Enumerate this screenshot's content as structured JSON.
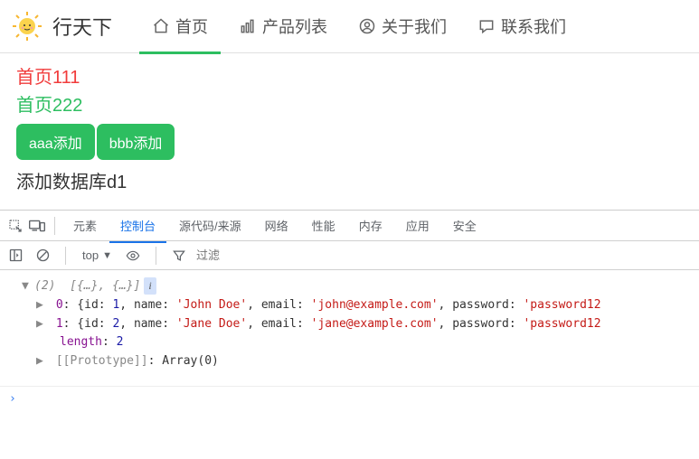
{
  "brand": "行天下",
  "nav": {
    "home": "首页",
    "products": "产品列表",
    "about": "关于我们",
    "contact": "联系我们"
  },
  "page": {
    "t1": "首页111",
    "t2": "首页222",
    "btn_a": "aaa添加",
    "btn_b": "bbb添加",
    "db": "添加数据库d1"
  },
  "devtools": {
    "tabs": {
      "elements": "元素",
      "console": "控制台",
      "sources": "源代码/来源",
      "network": "网络",
      "performance": "性能",
      "memory": "内存",
      "application": "应用",
      "security": "安全"
    },
    "context": "top",
    "filter_placeholder": "过滤",
    "data": {
      "count": "(2)",
      "preview": "[{…}, {…}]",
      "rows": [
        {
          "idx": "0",
          "id": "1",
          "name": "John Doe",
          "email": "john@example.com",
          "pwd_frag": "password12"
        },
        {
          "idx": "1",
          "id": "2",
          "name": "Jane Doe",
          "email": "jane@example.com",
          "pwd_frag": "password12"
        }
      ],
      "length_label": "length",
      "length_val": "2",
      "proto_label": "[[Prototype]]",
      "proto_val": "Array(0)"
    },
    "labels": {
      "id": "id",
      "name": "name",
      "email": "email",
      "password": "password"
    }
  }
}
